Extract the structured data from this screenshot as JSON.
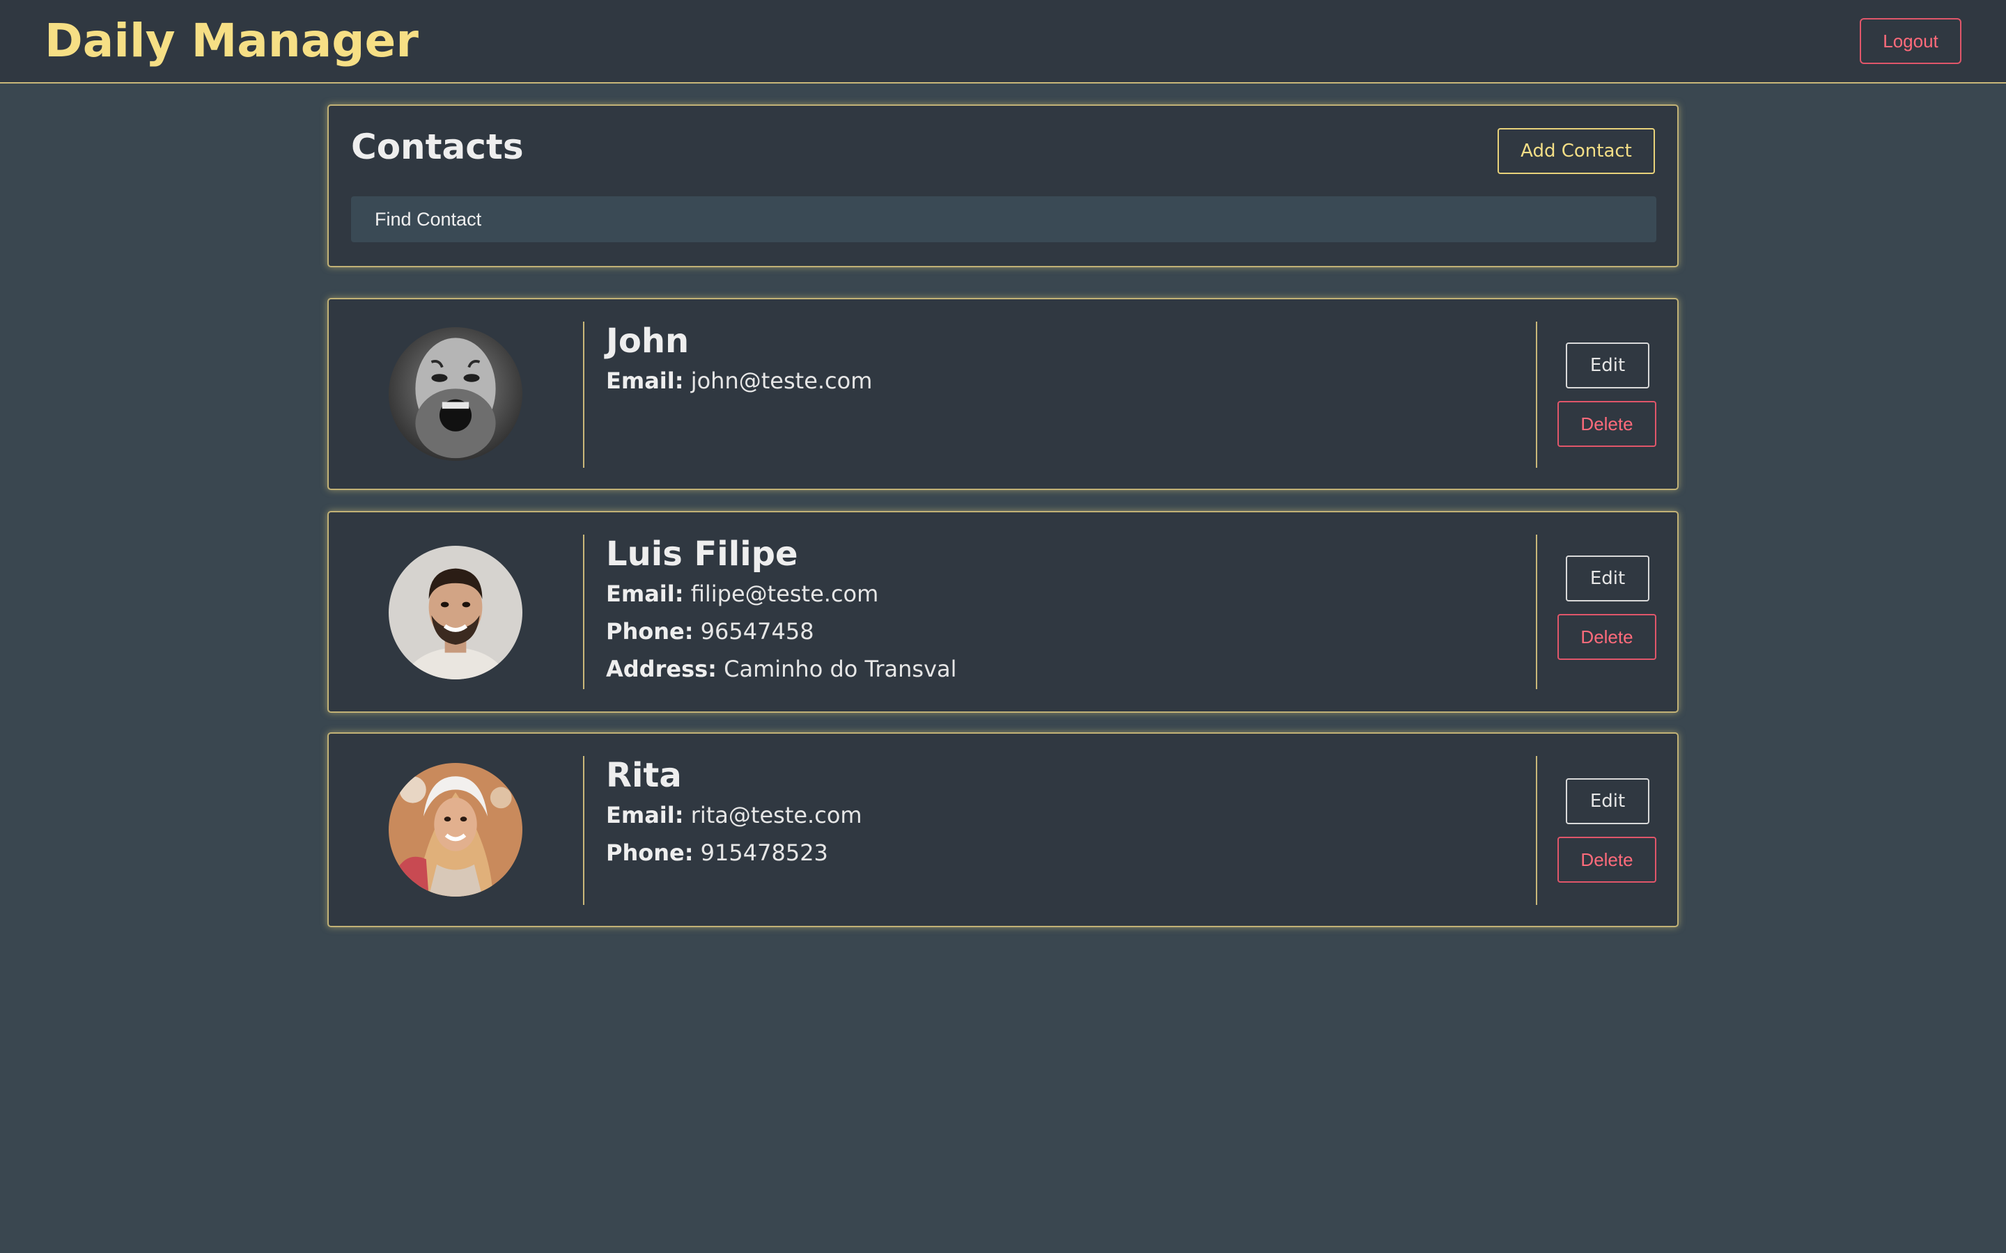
{
  "header": {
    "app_title": "Daily Manager",
    "logout_label": "Logout"
  },
  "contacts_panel": {
    "title": "Contacts",
    "add_contact_label": "Add Contact",
    "search_placeholder": "Find Contact"
  },
  "contacts": [
    {
      "name": "John",
      "email_label": "Email:",
      "email": "john@teste.com",
      "avatar": "photo-avatar-bearded-man-grayscale",
      "edit_label": "Edit",
      "delete_label": "Delete"
    },
    {
      "name": "Luis Filipe",
      "email_label": "Email:",
      "email": "filipe@teste.com",
      "phone_label": "Phone:",
      "phone": "96547458",
      "address_label": "Address:",
      "address": "Caminho do Transval",
      "avatar": "photo-avatar-smiling-man",
      "edit_label": "Edit",
      "delete_label": "Delete"
    },
    {
      "name": "Rita",
      "email_label": "Email:",
      "email": "rita@teste.com",
      "phone_label": "Phone:",
      "phone": "915478523",
      "avatar": "photo-avatar-smiling-woman",
      "edit_label": "Edit",
      "delete_label": "Delete"
    }
  ],
  "colors": {
    "background": "#3a4750",
    "surface": "#303841",
    "accent": "#f6df85",
    "card_border": "#c2b276",
    "danger": "#ff6b7b",
    "text": "#eeeeee"
  }
}
